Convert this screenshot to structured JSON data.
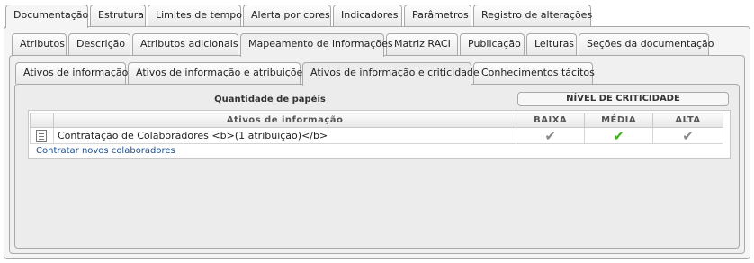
{
  "tabs_level1": [
    {
      "label": "Documentação",
      "active": true
    },
    {
      "label": "Estrutura"
    },
    {
      "label": "Limites de tempo"
    },
    {
      "label": "Alerta por cores"
    },
    {
      "label": "Indicadores"
    },
    {
      "label": "Parâmetros"
    },
    {
      "label": "Registro de alterações"
    }
  ],
  "tabs_level2": [
    {
      "label": "Atributos"
    },
    {
      "label": "Descrição"
    },
    {
      "label": "Atributos adicionais"
    },
    {
      "label": "Mapeamento de informações",
      "active": true
    },
    {
      "label": "Matriz RACI"
    },
    {
      "label": "Publicação"
    },
    {
      "label": "Leituras"
    },
    {
      "label": "Seções da documentação"
    }
  ],
  "tabs_level3": [
    {
      "label": "Ativos de informação"
    },
    {
      "label": "Ativos de informação e atribuições"
    },
    {
      "label": "Ativos de informação e criticidade",
      "active": true
    },
    {
      "label": "Conhecimentos tácitos"
    }
  ],
  "content": {
    "roles_header": "Quantidade de papéis",
    "criticality_header": "NÍVEL DE CRITICIDADE",
    "columns": {
      "assets": "Ativos de informação",
      "low": "BAIXA",
      "medium": "MÉDIA",
      "high": "ALTA"
    },
    "rows": [
      {
        "text": "Contratação de Colaboradores <b>(1 atribuição)</b>",
        "icon": "document-icon",
        "low": "grey-check",
        "medium": "green-check",
        "high": "grey-check"
      }
    ],
    "link": "Contratar novos colaboradores"
  },
  "colors": {
    "check_grey": "#8a8a8a",
    "check_green": "#3db01e",
    "link": "#1f4e8c"
  }
}
